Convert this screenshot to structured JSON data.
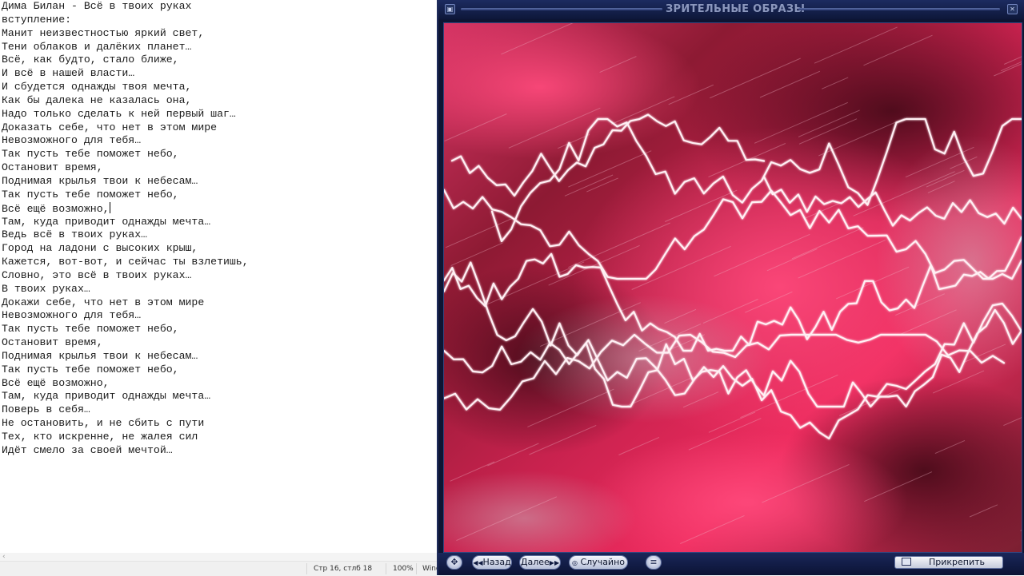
{
  "editor": {
    "lines": [
      "Дима Билан - Всё в твоих руках",
      "вступление:",
      "Манит неизвестностью яркий свет,",
      "Тени облаков и далёких планет…",
      "Всё, как будто, стало ближе,",
      "И всё в нашей власти…",
      "И сбудется однажды твоя мечта,",
      "Как бы далека не казалась она,",
      "Надо только сделать к ней первый шаг…",
      "Доказать себе, что нет в этом мире",
      "Невозможного для тебя…",
      "Так пусть тебе поможет небо,",
      "Остановит время,",
      "Поднимая крылья твои к небесам…",
      "Так пусть тебе поможет небо,",
      "Всё ещё возможно,",
      "Там, куда приводит однажды мечта…",
      "Ведь всё в твоих руках…",
      "Город на ладони с высоких крыш,",
      "Кажется, вот-вот, и сейчас ты взлетишь,",
      "Словно, это всё в твоих руках…",
      "В твоих руках…",
      "Докажи себе, что нет в этом мире",
      "Невозможного для тебя…",
      "Так пусть тебе поможет небо,",
      "Остановит время,",
      "Поднимая крылья твои к небесам…",
      "Так пусть тебе поможет небо,",
      "Всё ещё возможно,",
      "Там, куда приводит однажды мечта…",
      "Поверь в себя…",
      "Не остановить, и не сбить с пути",
      "Тех, кто искренне, не жалея сил",
      "Идёт смело за своей мечтой…"
    ],
    "caret_line": 15
  },
  "scrollbar": {
    "left_arrow": "‹"
  },
  "statusbar": {
    "position": "Стр 16, стлб 18",
    "zoom": "100%",
    "encoding": "Wind"
  },
  "player": {
    "title": "ЗРИТЕЛЬНЫЕ ОБРАЗЫ",
    "back_label": "Назад",
    "next_label": "Далее",
    "random_label": "Случайно",
    "attach_label": "Прикрепить",
    "colors": {
      "frame": "#0d1533",
      "viz_base": "#9a1535",
      "viz_hot": "#ff3670",
      "viz_dark": "#4a0b1a",
      "lines": "#fff0f4"
    }
  }
}
